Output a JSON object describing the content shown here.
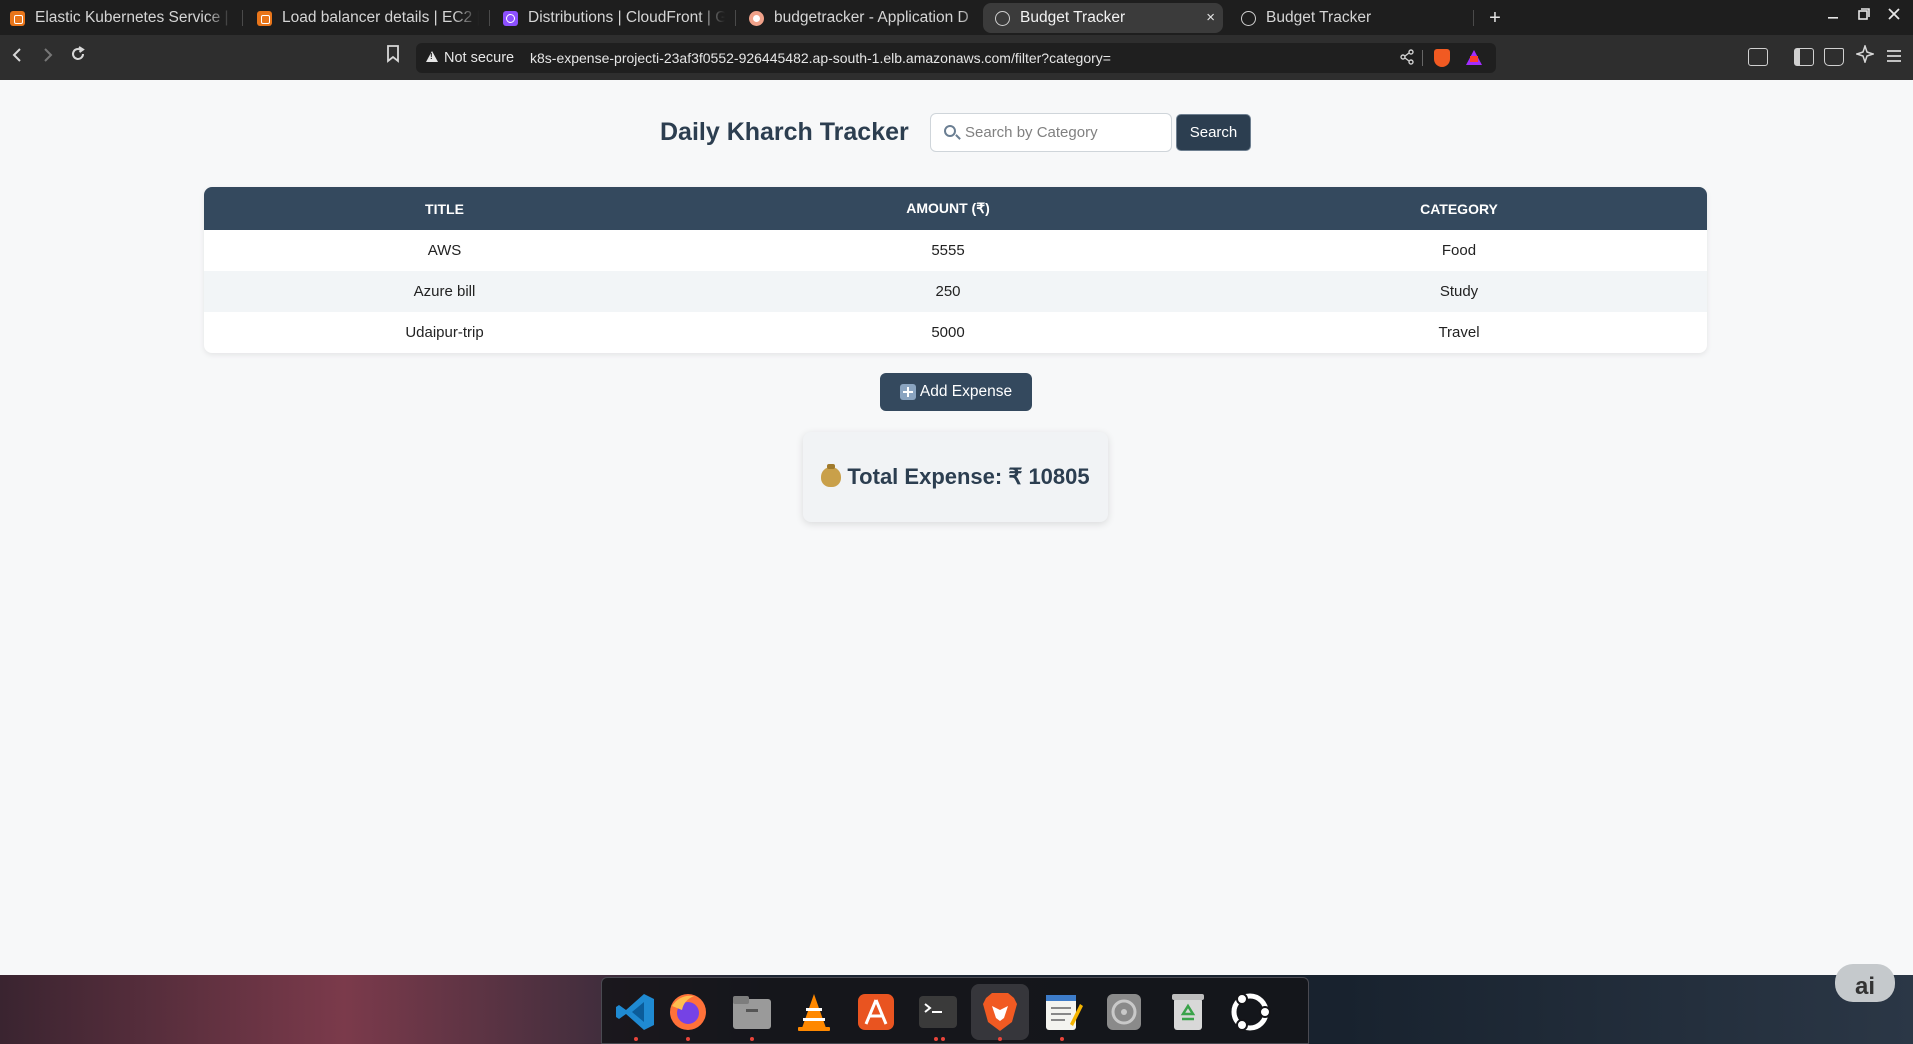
{
  "browser": {
    "tabs": [
      {
        "label": "Elastic Kubernetes Service | a",
        "icon": "aws-icon"
      },
      {
        "label": "Load balancer details | EC2 | a",
        "icon": "aws-icon"
      },
      {
        "label": "Distributions | CloudFront | G",
        "icon": "cloudfront-icon"
      },
      {
        "label": "budgetracker - Application D",
        "icon": "github-icon"
      },
      {
        "label": "Budget Tracker",
        "icon": "globe-icon",
        "active": true
      },
      {
        "label": "Budget Tracker",
        "icon": "globe-icon"
      }
    ],
    "new_tab": "+",
    "close_tab": "×",
    "security_label": "Not secure",
    "url": "k8s-expense-projecti-23af3f0552-926445482.ap-south-1.elb.amazonaws.com/filter?category="
  },
  "page": {
    "title": "Daily Kharch Tracker",
    "search": {
      "placeholder": "Search by Category",
      "value": "",
      "button_label": "Search"
    },
    "table": {
      "headers": [
        "TITLE",
        "AMOUNT (₹)",
        "CATEGORY"
      ],
      "rows": [
        {
          "title": "AWS",
          "amount": "5555",
          "category": "Food"
        },
        {
          "title": "Azure bill",
          "amount": "250",
          "category": "Study"
        },
        {
          "title": "Udaipur-trip",
          "amount": "5000",
          "category": "Travel"
        }
      ]
    },
    "add_button_label": "Add Expense",
    "total_label": "Total Expense: ₹ 10805"
  },
  "dock": {
    "apps": [
      "vscode-icon",
      "firefox-icon",
      "files-icon",
      "vlc-icon",
      "app-center-icon",
      "terminal-icon",
      "brave-icon",
      "text-editor-icon",
      "disks-icon",
      "trash-icon",
      "ubuntu-icon"
    ],
    "corner_badge": "ai"
  },
  "colors": {
    "primary": "#2c3e50",
    "table_header": "#34495e",
    "brave_orange": "#f15a22"
  }
}
